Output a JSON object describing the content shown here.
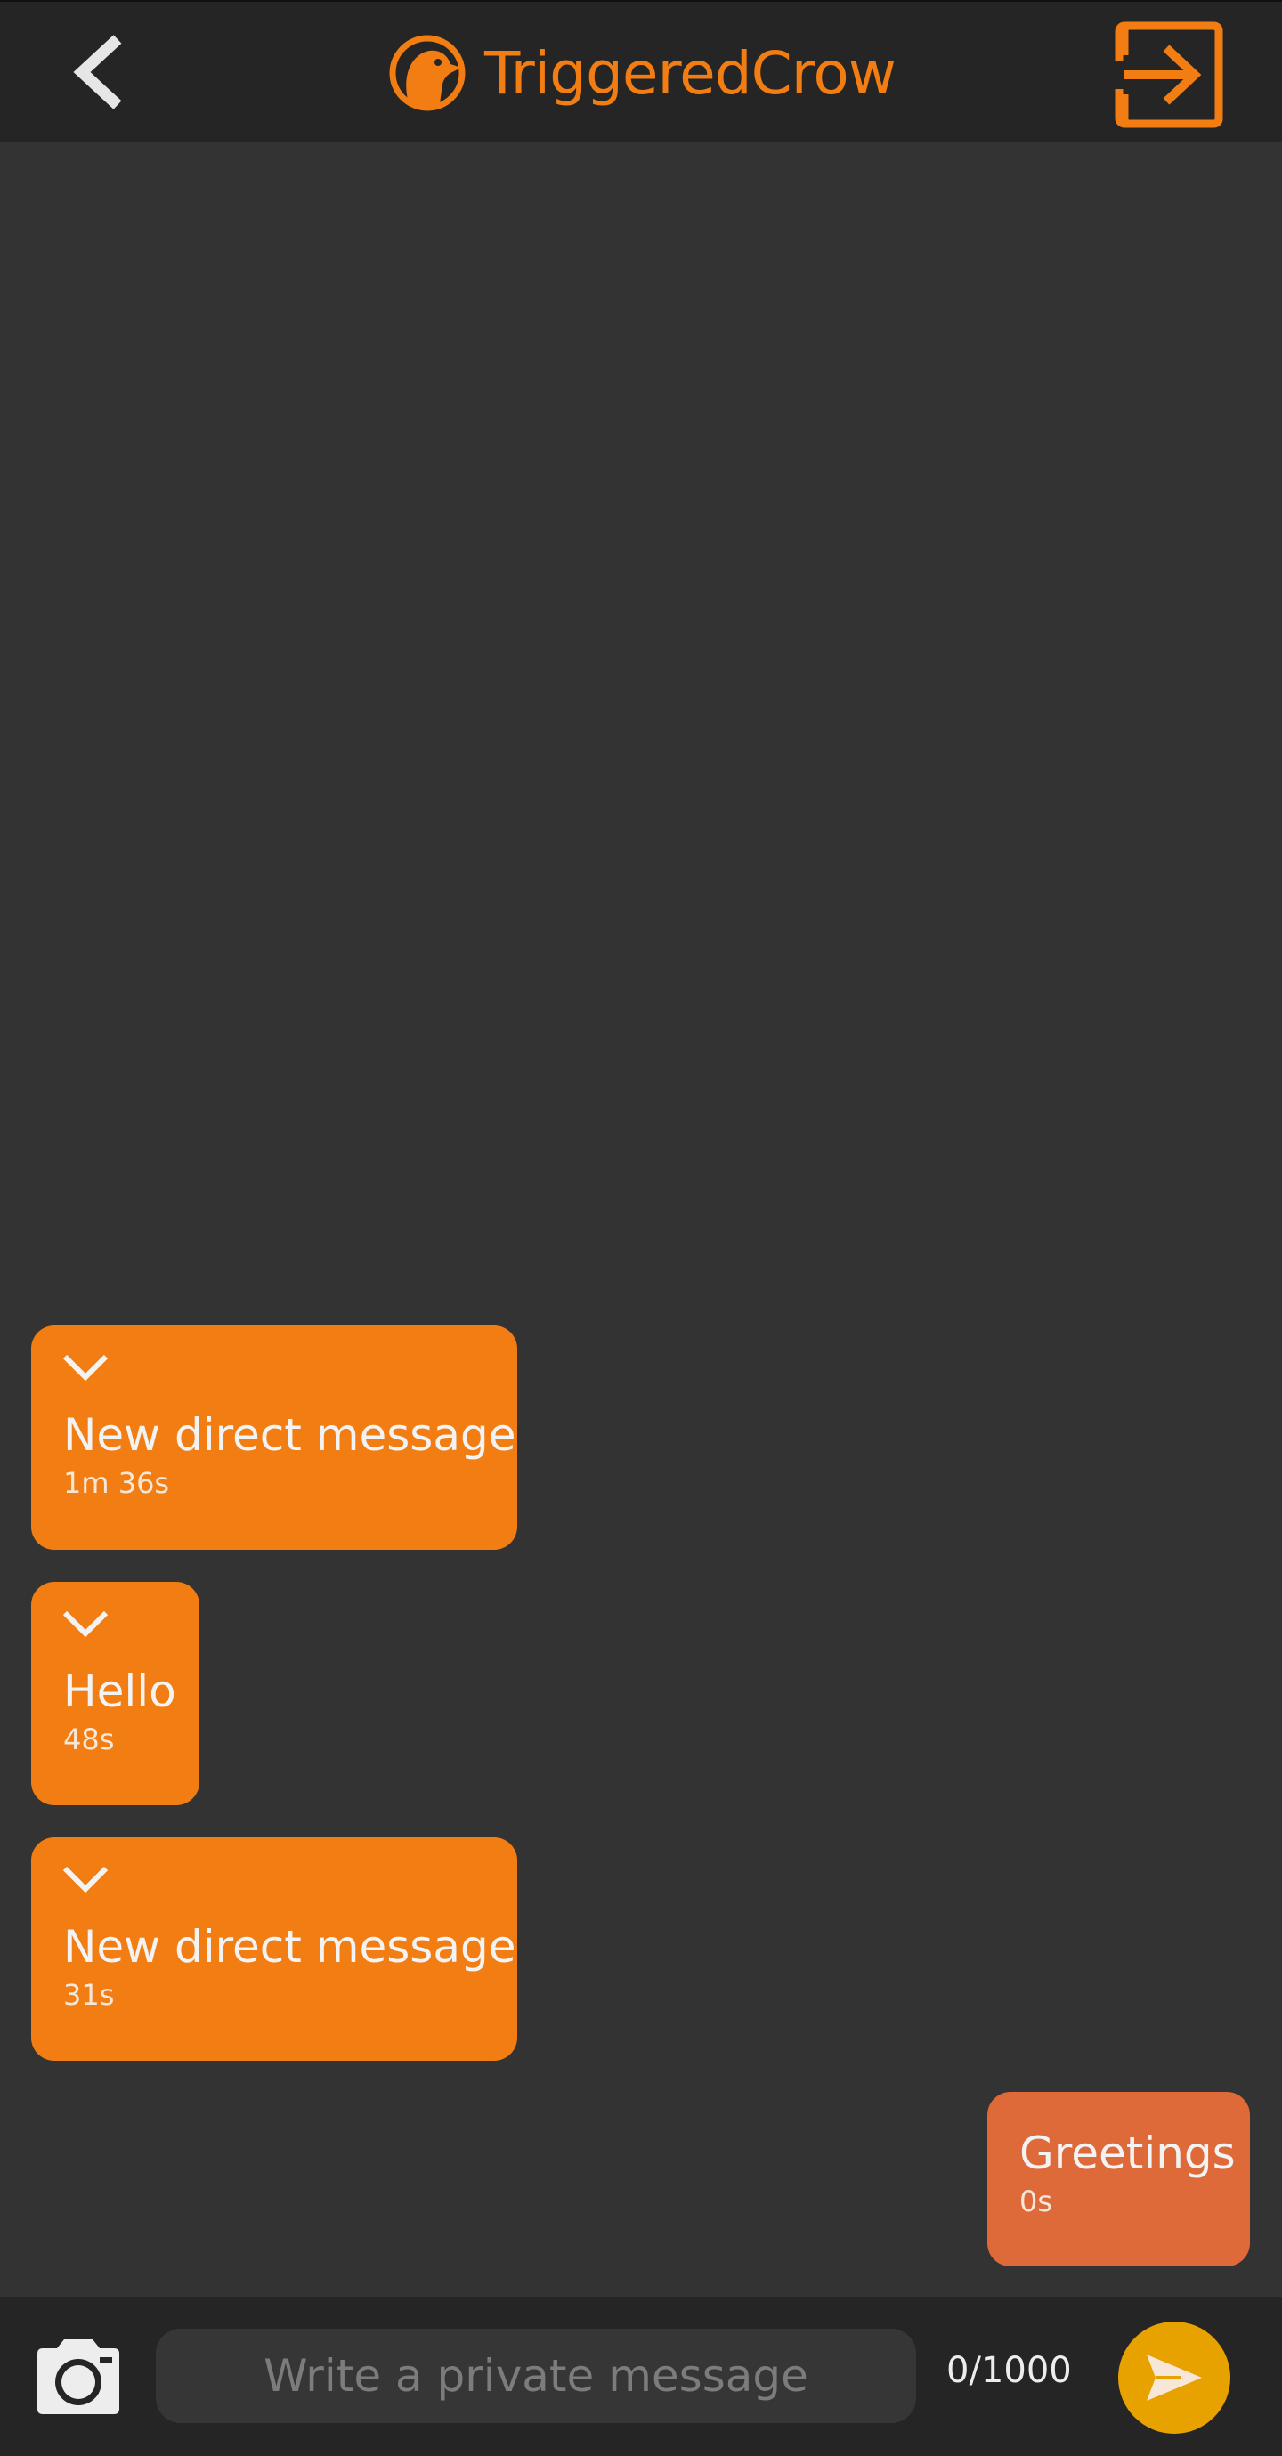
{
  "header": {
    "app_name": "TriggeredCrow",
    "back_icon": "chevron-left-icon",
    "logo_icon": "crow-logo-icon",
    "logout_icon": "logout-icon"
  },
  "colors": {
    "accent": "#F27D12",
    "incoming_bubble": "#F27D12",
    "outgoing_bubble": "#DE6939",
    "send_button": "#E8A200",
    "background": "#333333",
    "bar": "#252525"
  },
  "messages": [
    {
      "text": "New direct message",
      "time": "1m 36s",
      "direction": "incoming",
      "expand_icon": "chevron-down-icon"
    },
    {
      "text": "Hello",
      "time": "48s",
      "direction": "incoming",
      "expand_icon": "chevron-down-icon"
    },
    {
      "text": "New direct message",
      "time": "31s",
      "direction": "incoming",
      "expand_icon": "chevron-down-icon"
    },
    {
      "text": "Greetings",
      "time": "0s",
      "direction": "outgoing"
    }
  ],
  "composer": {
    "placeholder": "Write a private message",
    "value": "",
    "counter": "0/1000",
    "camera_icon": "camera-icon",
    "send_icon": "send-icon"
  }
}
